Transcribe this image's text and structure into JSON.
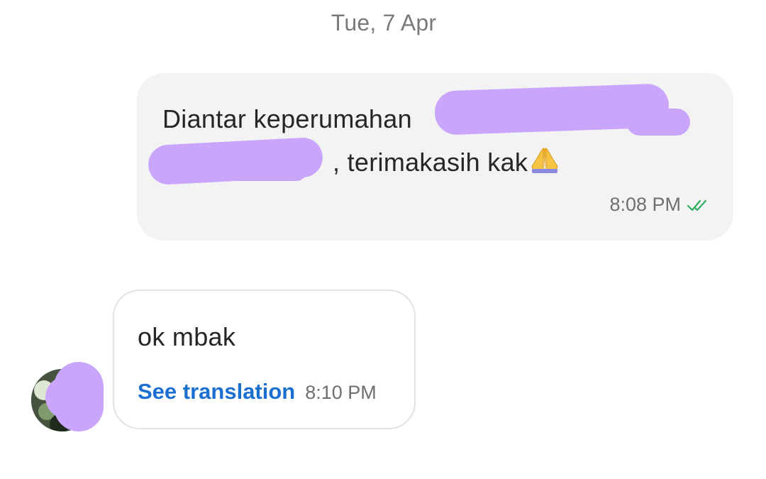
{
  "date_separator": "Tue, 7 Apr",
  "outgoing_message": {
    "line1_text": "Diantar keperumahan",
    "line2_text": ", terimakasih kak",
    "emoji": "folded-hands-emoji",
    "time": "8:08 PM",
    "status_icon": "double-check-icon",
    "status_color": "#2fae5f",
    "redaction_color": "#c9a6fb"
  },
  "incoming_message": {
    "text": "ok mbak",
    "translation_link": "See translation",
    "time": "8:10 PM",
    "link_color": "#1a6fd0"
  }
}
